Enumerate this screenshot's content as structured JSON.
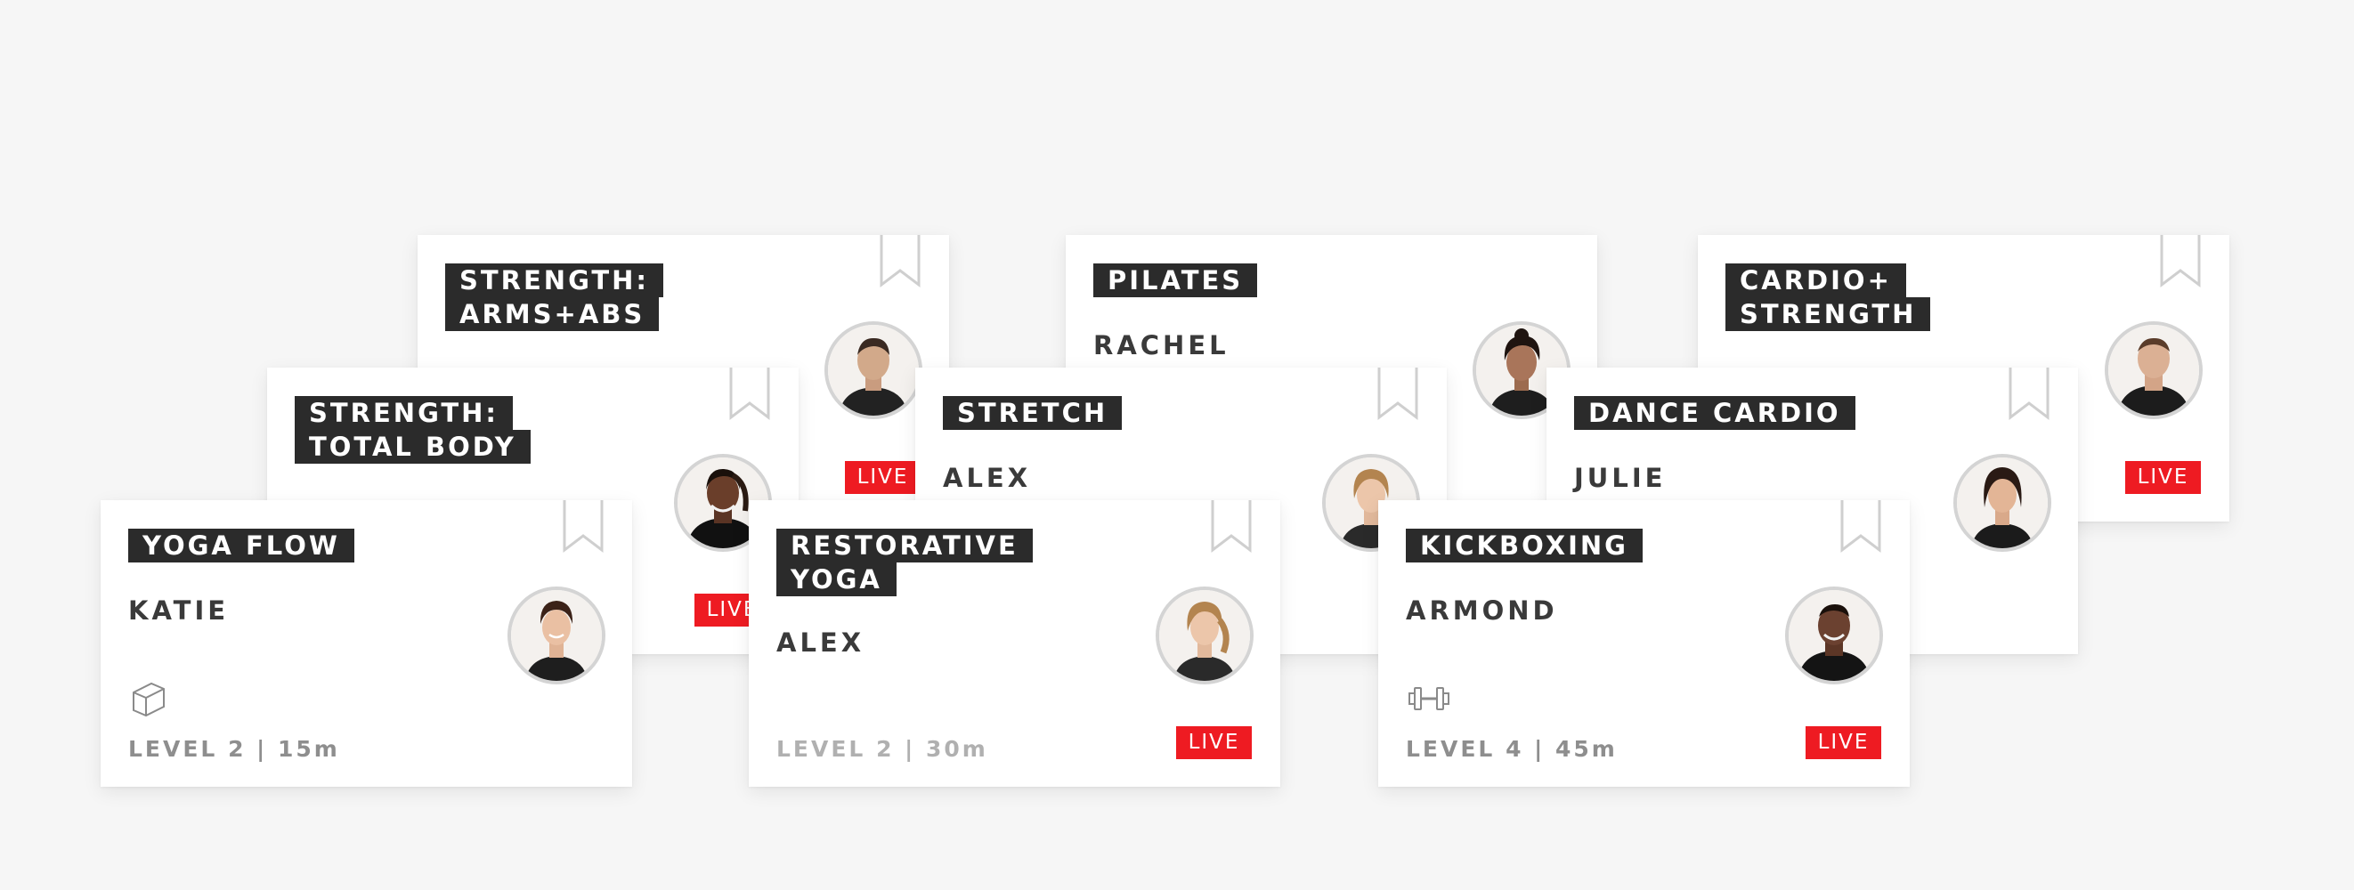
{
  "colors": {
    "background": "#f6f6f6",
    "card": "#ffffff",
    "title_bg": "#2b2b2b",
    "live_badge": "#ee1b22"
  },
  "cards": {
    "strength_arms_abs": {
      "title_line1": "STRENGTH:",
      "title_line2": "ARMS+ABS",
      "live": "LIVE"
    },
    "pilates": {
      "title_line1": "PILATES",
      "instructor": "RACHEL"
    },
    "cardio_strength": {
      "title_line1": "CARDIO+",
      "title_line2": "STRENGTH",
      "live": "LIVE"
    },
    "strength_total_body": {
      "title_line1": "STRENGTH:",
      "title_line2": "TOTAL BODY",
      "live": "LIVE"
    },
    "stretch": {
      "title_line1": "STRETCH",
      "instructor": "ALEX"
    },
    "dance_cardio": {
      "title_line1": "DANCE CARDIO",
      "instructor": "JULIE"
    },
    "yoga_flow": {
      "title_line1": "YOGA FLOW",
      "instructor": "KATIE",
      "equipment_icon": "yoga-block-icon",
      "level": "LEVEL 2 | 15m"
    },
    "restorative_yoga": {
      "title_line1": "RESTORATIVE",
      "title_line2": "YOGA",
      "instructor": "ALEX",
      "level": "LEVEL 2 | 30m",
      "live": "LIVE"
    },
    "kickboxing": {
      "title_line1": "KICKBOXING",
      "instructor": "ARMOND",
      "equipment_icon": "dumbbell-icon",
      "level": "LEVEL 4 | 45m",
      "live": "LIVE"
    }
  }
}
